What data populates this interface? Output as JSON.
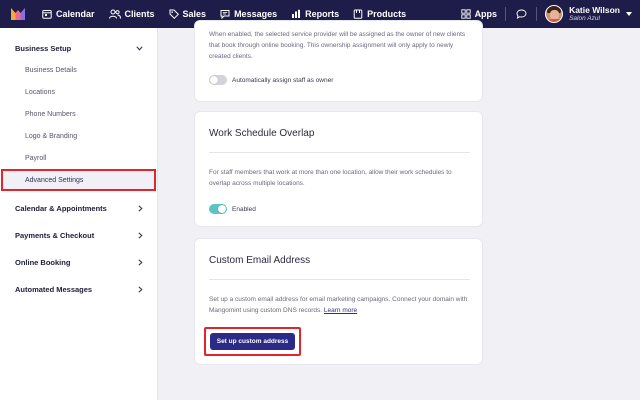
{
  "topnav": {
    "items": [
      {
        "label": "Calendar",
        "icon": "calendar-icon"
      },
      {
        "label": "Clients",
        "icon": "users-icon"
      },
      {
        "label": "Sales",
        "icon": "tag-icon"
      },
      {
        "label": "Messages",
        "icon": "chat-bubble-icon"
      },
      {
        "label": "Reports",
        "icon": "bar-chart-icon"
      },
      {
        "label": "Products",
        "icon": "box-icon"
      }
    ],
    "apps_label": "Apps",
    "user_name": "Katie Wilson",
    "user_org": "Salon Azul"
  },
  "sidebar": {
    "business_setup": "Business Setup",
    "sub_items": [
      "Business Details",
      "Locations",
      "Phone Numbers",
      "Logo & Branding",
      "Payroll",
      "Advanced Settings"
    ],
    "sections": [
      "Calendar & Appointments",
      "Payments & Checkout",
      "Online Booking",
      "Automated Messages"
    ]
  },
  "cards": {
    "owner": {
      "desc": "When enabled, the selected service provider will be assigned as the owner of new clients that book through online booking. This ownership assignment will only apply to newly created clients.",
      "toggle_label": "Automatically assign staff as owner"
    },
    "schedule": {
      "title": "Work Schedule Overlap",
      "desc": "For staff members that work at more than one location, allow their work schedules to overlap across multiple locations.",
      "toggle_label": "Enabled"
    },
    "email": {
      "title": "Custom Email Address",
      "desc": "Set up a custom email address for email marketing campaigns. Connect your domain with Mangomint using custom DNS records.",
      "link": "Learn more",
      "button": "Set up custom address"
    }
  },
  "colors": {
    "nav_bg": "#1e1d4a",
    "accent": "#2b2a86",
    "highlight": "#e0262c",
    "toggle_on": "#5bc4c4",
    "toggle_off": "#d3d3db"
  }
}
